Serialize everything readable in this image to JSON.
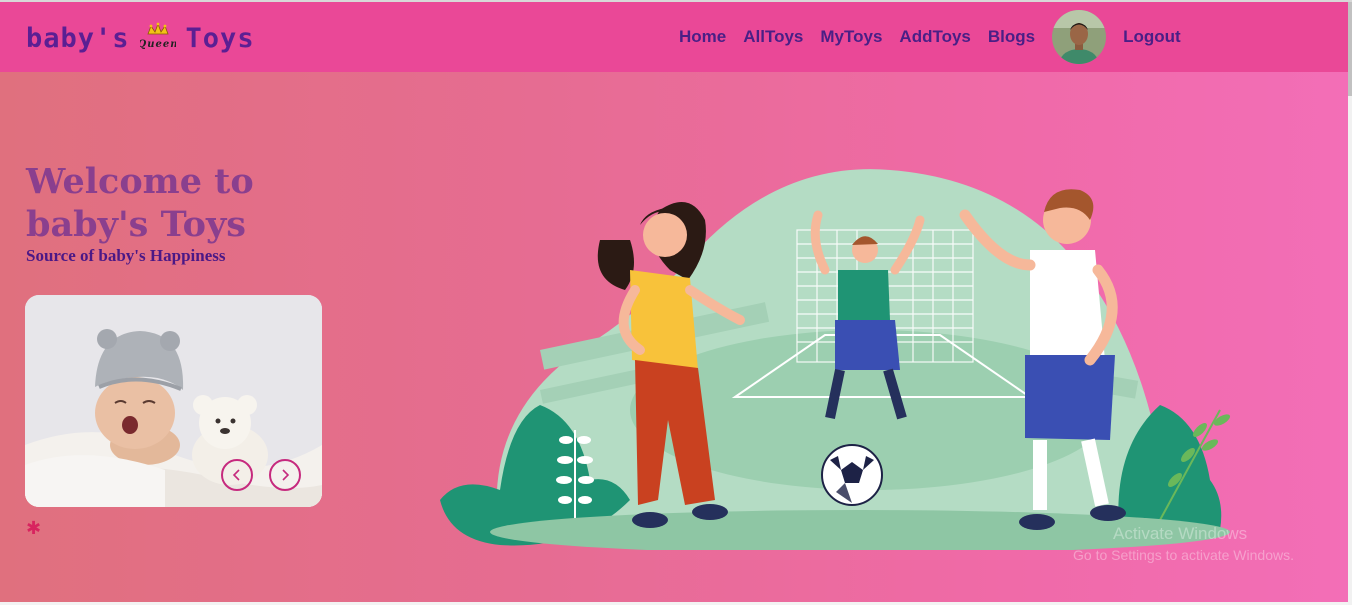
{
  "brand": {
    "name_left": "baby's",
    "name_right": "Toys",
    "crown_word": "Queen"
  },
  "nav": {
    "links": [
      "Home",
      "AllToys",
      "MyToys",
      "AddToys",
      "Blogs"
    ],
    "logout": "Logout"
  },
  "hero": {
    "title": "Welcome to baby's Toys",
    "subtitle": "Source of baby's Happiness"
  },
  "carousel": {
    "prev_icon": "chevron-left-icon",
    "next_icon": "chevron-right-icon"
  },
  "watermark": {
    "line1": "Activate Windows",
    "line2": "Go to Settings to activate Windows."
  },
  "colors": {
    "navbar": "#ea4897",
    "brand_text": "#5b1f93",
    "accent": "#c62a7e"
  }
}
